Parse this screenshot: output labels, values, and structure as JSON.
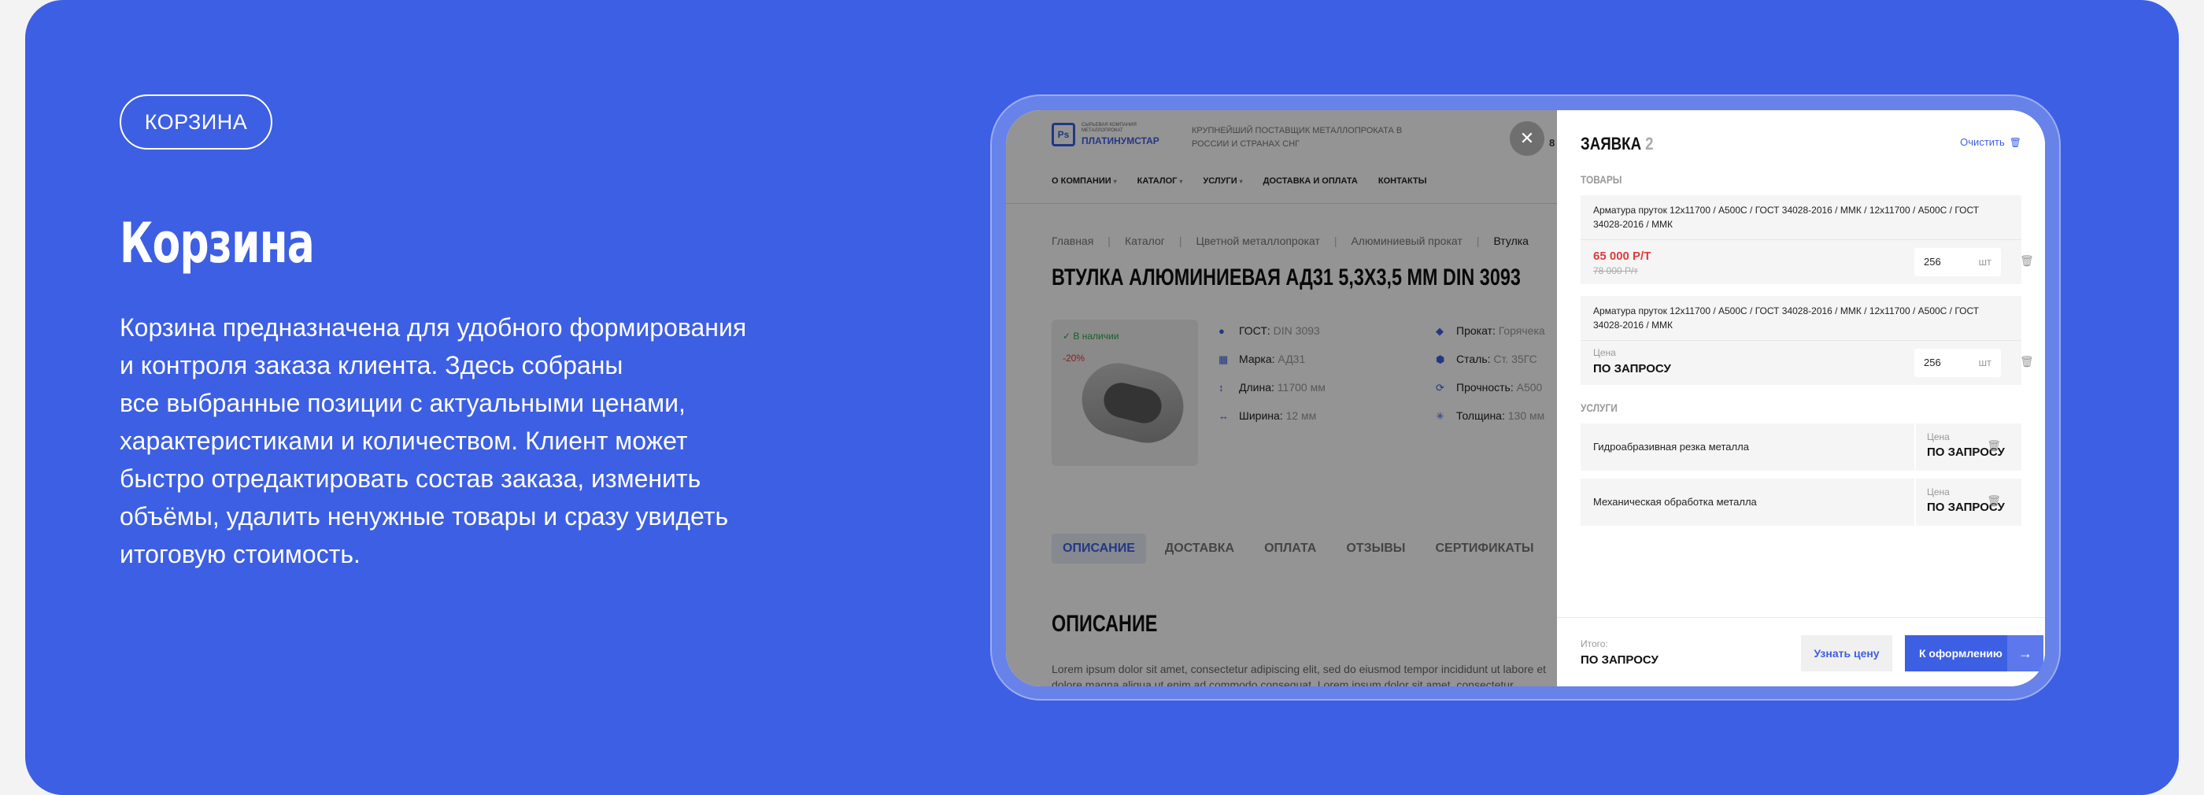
{
  "slide": {
    "tag": "КОРЗИНА",
    "title": "Корзина",
    "lines": [
      "Корзина предназначена для удобного формирования",
      "и контроля заказа клиента. Здесь собраны",
      "все выбранные позиции с актуальными ценами,",
      "характеристиками и количеством. Клиент может",
      "быстро отредактировать состав заказа, изменить",
      "объёмы, удалить ненужные товары и сразу увидеть",
      "итоговую стоимость."
    ]
  },
  "site": {
    "logo_mark": "Ps",
    "logo_small": "СЫРЬЕВАЯ КОМПАНИЯ МЕТАЛЛОПРОКАТ",
    "logo_name": "ПЛАТИНУМСТАР",
    "tagline": "КРУПНЕЙШИЙ ПОСТАВЩИК МЕТАЛЛОПРОКАТА В РОССИИ И СТРАНАХ СНГ",
    "phone_peek": "8",
    "nav": [
      "О КОМПАНИИ",
      "КАТАЛОГ",
      "УСЛУГИ",
      "ДОСТАВКА И ОПЛАТА",
      "КОНТАКТЫ"
    ],
    "crumbs": [
      "Главная",
      "Каталог",
      "Цветной металлопрокат",
      "Алюминиевый прокат",
      "Втулка"
    ],
    "product_title": "ВТУЛКА АЛЮМИНИЕВАЯ АД31 5,3Х3,5 ММ DIN 3093",
    "in_stock": "✓ В наличии",
    "discount": "-20%",
    "specs_left": [
      {
        "icon": "gost-icon",
        "glyph": "●",
        "label": "ГОСТ:",
        "value": "DIN 3093"
      },
      {
        "icon": "grade-icon",
        "glyph": "▦",
        "label": "Марка:",
        "value": "АД31"
      },
      {
        "icon": "length-icon",
        "glyph": "↕",
        "label": "Длина:",
        "value": "11700 мм"
      },
      {
        "icon": "width-icon",
        "glyph": "↔",
        "label": "Ширина:",
        "value": "12 мм"
      }
    ],
    "specs_right": [
      {
        "icon": "rolling-icon",
        "glyph": "◆",
        "label": "Прокат:",
        "value": "Горячека"
      },
      {
        "icon": "steel-icon",
        "glyph": "⬢",
        "label": "Сталь:",
        "value": "Ст. 35ГС"
      },
      {
        "icon": "strength-icon",
        "glyph": "⟳",
        "label": "Прочность:",
        "value": "А500"
      },
      {
        "icon": "thickness-icon",
        "glyph": "✳",
        "label": "Толщина:",
        "value": "130 мм"
      }
    ],
    "tabs": [
      "ОПИСАНИЕ",
      "ДОСТАВКА",
      "ОПЛАТА",
      "ОТЗЫВЫ",
      "СЕРТИФИКАТЫ"
    ],
    "section_title": "ОПИСАНИЕ",
    "lorem": "Lorem ipsum dolor sit amet, consectetur adipiscing elit, sed do eiusmod tempor incididunt ut labore et dolore magna aliqua ut enim ad commodo consequat. Lorem ipsum dolor sit amet, consectetur adipiscing"
  },
  "cart": {
    "close_glyph": "✕",
    "title": "ЗАЯВКА",
    "count": "2",
    "clear_label": "Очистить",
    "goods_label": "ТОВАРЫ",
    "services_label": "УСЛУГИ",
    "items": [
      {
        "name": "Арматура пруток 12х11700 / А500С / ГОСТ 34028-2016 /  ММК / 12х11700 / А500С / ГОСТ 34028-2016 /  ММК",
        "price_new": "65 000 Р/Т",
        "price_old": "78 000 Р/т",
        "qty": "256",
        "unit": "шт"
      },
      {
        "name": "Арматура пруток 12х11700 / А500С / ГОСТ 34028-2016 /  ММК / 12х11700 / А500С / ГОСТ 34028-2016 /  ММК",
        "price_label": "Цена",
        "price_value": "ПО ЗАПРОСУ",
        "qty": "256",
        "unit": "шт"
      }
    ],
    "services": [
      {
        "name": "Гидроабразивная резка металла",
        "price_label": "Цена",
        "price_value": "ПО ЗАПРОСУ"
      },
      {
        "name": "Механическая обработка металла",
        "price_label": "Цена",
        "price_value": "ПО ЗАПРОСУ"
      }
    ],
    "total_label": "Итого:",
    "total_value": "ПО ЗАПРОСУ",
    "ask_price_label": "Узнать цену",
    "checkout_label": "К оформлению",
    "checkout_arrow": "→",
    "trash_glyph": "🗑"
  },
  "colors": {
    "accent": "#3d5fe3",
    "sale": "#e23b3b",
    "stock": "#2aa64a"
  }
}
